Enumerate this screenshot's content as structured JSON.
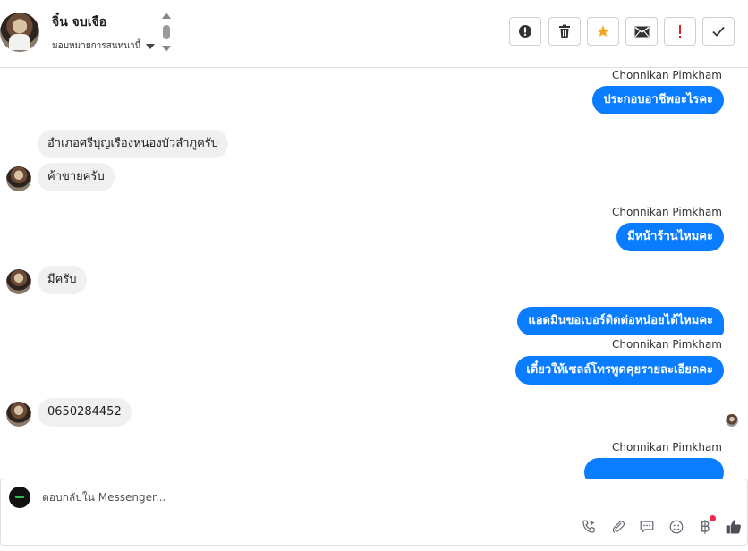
{
  "header": {
    "contact_name": "จิ๋น จบเจือ",
    "assign_label": "มอบหมายการสนทนานี้",
    "actions": [
      {
        "name": "spam-button",
        "glyph": "!",
        "icon": "alert-circle-icon"
      },
      {
        "name": "delete-button",
        "glyph": "🗑",
        "icon": "trash-icon"
      },
      {
        "name": "star-button",
        "glyph": "★",
        "icon": "star-icon",
        "color": "#f5a623"
      },
      {
        "name": "mark-unread-button",
        "glyph": "✉",
        "icon": "envelope-icon"
      },
      {
        "name": "follow-up-button",
        "glyph": "!",
        "icon": "exclamation-icon",
        "color": "#e02020"
      },
      {
        "name": "done-button",
        "glyph": "✓",
        "icon": "checkmark-icon"
      }
    ]
  },
  "messages": {
    "sender_1": "Chonnikan Pimkham",
    "out_1": "ประกอบอาชีพอะไรคะ",
    "in_1": "อำเภอศรีบุญเรืองหนองบัวลำภูครับ",
    "in_2": "ค้าขายครับ",
    "sender_2": "Chonnikan Pimkham",
    "out_2": "มีหน้าร้านไหมคะ",
    "in_3": "มีครับ",
    "out_3": "แอดมินขอเบอร์ติดต่อหน่อยได้ไหมคะ",
    "sender_3": "Chonnikan Pimkham",
    "out_4": "เดี๋ยวให้เซลล์โทรพูดคุยรายละเอียดคะ",
    "in_4": "0650284452",
    "sender_4": "Chonnikan Pimkham"
  },
  "composer": {
    "placeholder": "ตอบกลับใน Messenger...",
    "icons": [
      "phone-plus-icon",
      "attachment-icon",
      "saved-reply-icon",
      "emoji-icon",
      "baht-icon",
      "thumbs-up-icon"
    ]
  },
  "colors": {
    "outgoing_bubble": "#0a7cff",
    "incoming_bubble": "#f0f0f0",
    "star": "#f5a623",
    "alert_red": "#e02020"
  }
}
